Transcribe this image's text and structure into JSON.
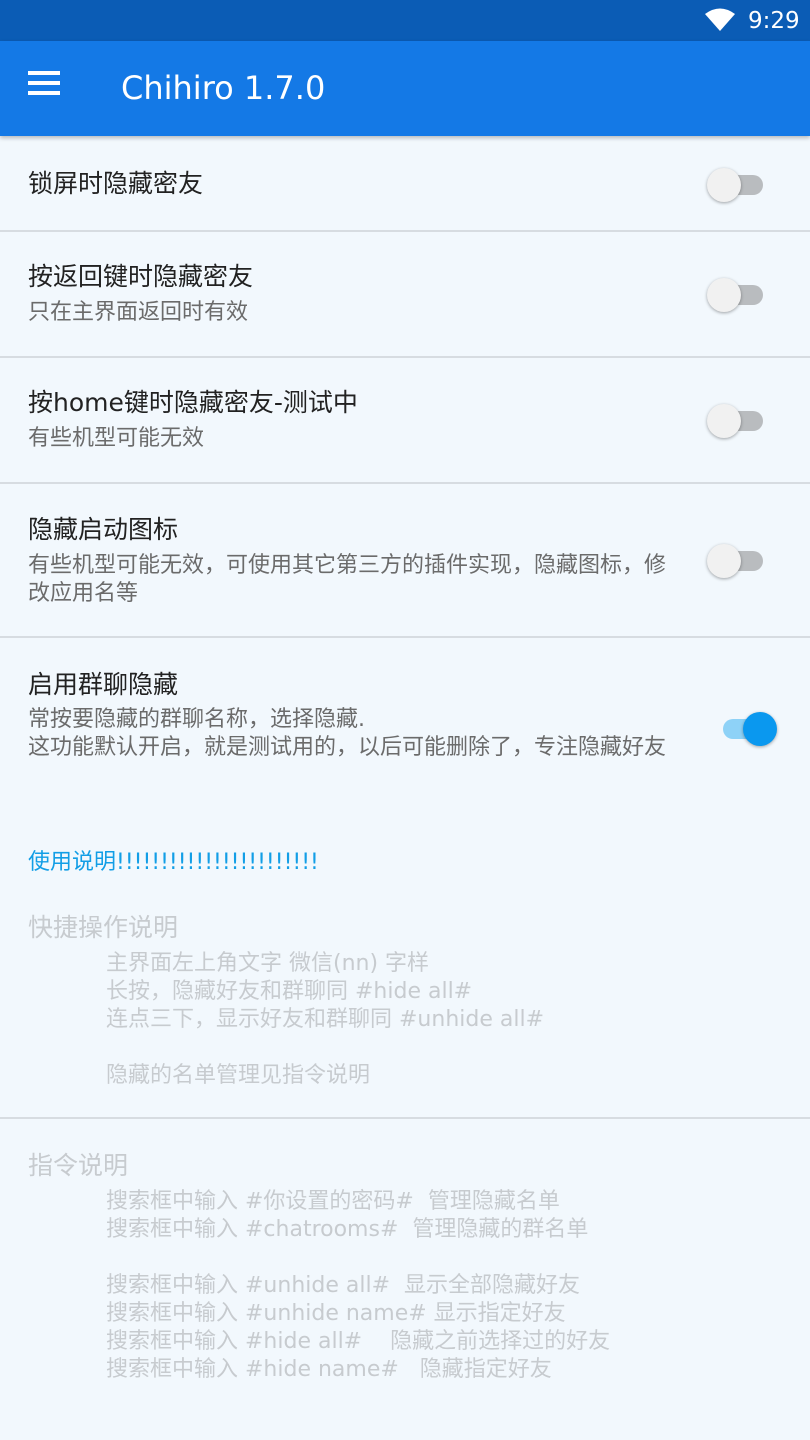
{
  "status_bar": {
    "time": "9:29",
    "wifi_icon": "wifi-icon"
  },
  "app_bar": {
    "title": "Chihiro  1.7.0",
    "menu_icon": "hamburger-menu-icon"
  },
  "settings": [
    {
      "title": "锁屏时隐藏密友",
      "summary": "",
      "enabled": false
    },
    {
      "title": "按返回键时隐藏密友",
      "summary": "只在主界面返回时有效",
      "enabled": false
    },
    {
      "title": "按home键时隐藏密友-测试中",
      "summary": "有些机型可能无效",
      "enabled": false
    },
    {
      "title": "隐藏启动图标",
      "summary": "有些机型可能无效，可使用其它第三方的插件实现，隐藏图标，修改应用名等",
      "enabled": false
    },
    {
      "title": "启用群聊隐藏",
      "summary": "常按要隐藏的群聊名称，选择隐藏.\n这功能默认开启，就是测试用的，以后可能删除了，专注隐藏好友",
      "enabled": true
    }
  ],
  "usage_link": "使用说明!!!!!!!!!!!!!!!!!!!!!!!",
  "quick_ops": {
    "heading": "快捷操作说明",
    "lines": [
      "主界面左上角文字 微信(nn) 字样",
      "长按，隐藏好友和群聊同 #hide all#",
      "连点三下，显示好友和群聊同 #unhide all#",
      "隐藏的名单管理见指令说明"
    ]
  },
  "commands": {
    "heading": "指令说明",
    "lines": [
      "搜索框中输入 #你设置的密码#  管理隐藏名单",
      "搜索框中输入 #chatrooms#  管理隐藏的群名单",
      "搜索框中输入 #unhide all#  显示全部隐藏好友",
      "搜索框中输入 #unhide name# 显示指定好友",
      "搜索框中输入 #hide all#    隐藏之前选择过的好友",
      "搜索框中输入 #hide name#   隐藏指定好友"
    ]
  },
  "colors": {
    "status_bar": "#0b5cb5",
    "app_bar": "#1479e6",
    "switch_on": "#0a98ef",
    "link": "#129ee6"
  }
}
